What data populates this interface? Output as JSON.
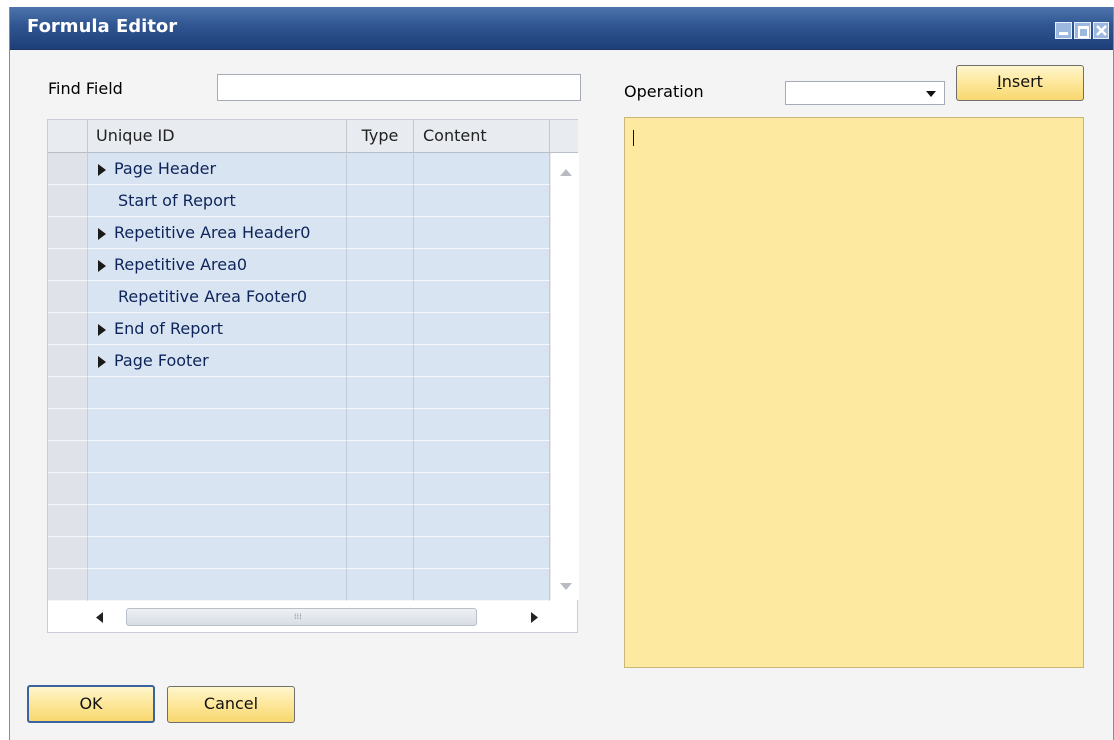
{
  "window": {
    "title": "Formula Editor",
    "controls": [
      "minimize-icon",
      "maximize-icon",
      "close-icon"
    ]
  },
  "find_field": {
    "label": "Find Field",
    "value": ""
  },
  "grid": {
    "columns": [
      "Unique ID",
      "Type",
      "Content"
    ],
    "rows": [
      {
        "label": "Page Header",
        "expandable": true,
        "type": "",
        "content": ""
      },
      {
        "label": "Start of Report",
        "expandable": false,
        "type": "",
        "content": ""
      },
      {
        "label": "Repetitive Area Header0",
        "expandable": true,
        "type": "",
        "content": ""
      },
      {
        "label": "Repetitive Area0",
        "expandable": true,
        "type": "",
        "content": ""
      },
      {
        "label": "Repetitive Area Footer0",
        "expandable": false,
        "type": "",
        "content": ""
      },
      {
        "label": "End of Report",
        "expandable": true,
        "type": "",
        "content": ""
      },
      {
        "label": "Page Footer",
        "expandable": true,
        "type": "",
        "content": ""
      }
    ],
    "empty_rows": 7
  },
  "operation": {
    "label": "Operation",
    "selected": ""
  },
  "insert_button": {
    "label": "Insert",
    "mnemonic": "I"
  },
  "formula_text": "",
  "ok_button": {
    "label": "OK"
  },
  "cancel_button": {
    "label": "Cancel"
  },
  "colors": {
    "titlebar": "#2f5591",
    "row_bg": "#d9e4f2",
    "row_text": "#0c2459",
    "editor_bg": "#fdeaa0",
    "button_bg": "#fde79a"
  }
}
